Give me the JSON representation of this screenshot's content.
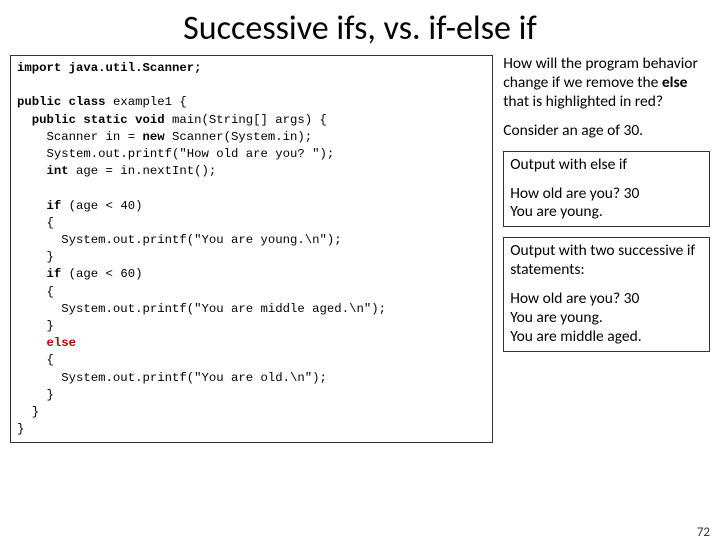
{
  "title": "Successive ifs, vs. if-else if",
  "code": {
    "l1": "import java.util.Scanner;",
    "l2": "",
    "l3a": "public class",
    "l3b": " example1 {",
    "l4a": "  public static void",
    "l4b": " main(String[] args) {",
    "l5a": "    Scanner in = ",
    "l5b": "new",
    "l5c": " Scanner(System.in);",
    "l6": "    System.out.printf(\"How old are you? \");",
    "l7a": "    int",
    "l7b": " age = in.nextInt();",
    "l8": "",
    "l9a": "    if",
    "l9b": " (age < 40)",
    "l10": "    {",
    "l11": "      System.out.printf(\"You are young.\\n\");",
    "l12": "    }",
    "l13a": "    if",
    "l13b": " (age < 60)",
    "l14": "    {",
    "l15": "      System.out.printf(\"You are middle aged.\\n\");",
    "l16": "    }",
    "l17": "    else",
    "l18": "    {",
    "l19": "      System.out.printf(\"You are old.\\n\");",
    "l20": "    }",
    "l21": "  }",
    "l22": "}"
  },
  "right": {
    "q1": "How will the program behavior change if we remove the ",
    "q_else": "else",
    "q2": " that is highlighted in red?",
    "consider": "Consider an age of 30.",
    "out_else_title": "Output with else if",
    "out_else_1": "How old are you? 30",
    "out_else_2": "You are young.",
    "out_if_title": "Output with two successive if statements:",
    "out_if_1": "How old are you? 30",
    "out_if_2": "You are young.",
    "out_if_3": "You are middle aged."
  },
  "pagenum": "72"
}
